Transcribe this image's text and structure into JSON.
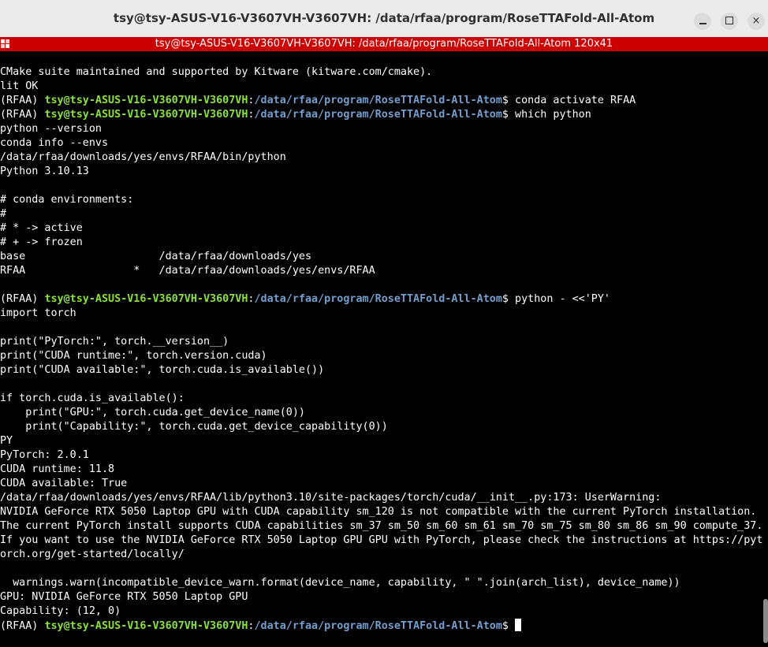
{
  "window": {
    "title": "tsy@tsy-ASUS-V16-V3607VH-V3607VH: /data/rfaa/program/RoseTTAFold-All-Atom",
    "min_label": "",
    "max_label": "",
    "close_label": "×"
  },
  "statusbar": {
    "text": "tsy@tsy-ASUS-V16-V3607VH-V3607VH: /data/rfaa/program/RoseTTAFold-All-Atom 120x41"
  },
  "prompt": {
    "env": "(RFAA) ",
    "user": "tsy@tsy-ASUS-V16-V3607VH-V3607VH",
    "colon": ":",
    "path": "/data/rfaa/program/RoseTTAFold-All-Atom",
    "dollar": "$ "
  },
  "terminal": {
    "l01": "CMake suite maintained and supported by Kitware (kitware.com/cmake).",
    "l02": "lit OK",
    "cmd03": "conda activate RFAA",
    "cmd04": "which python",
    "l05": "python --version",
    "l06": "conda info --envs",
    "l07": "/data/rfaa/downloads/yes/envs/RFAA/bin/python",
    "l08": "Python 3.10.13",
    "l09": "",
    "l10": "# conda environments:",
    "l11": "#",
    "l12": "# * -> active",
    "l13": "# + -> frozen",
    "l14": "base                     /data/rfaa/downloads/yes",
    "l15": "RFAA                 *   /data/rfaa/downloads/yes/envs/RFAA",
    "l16": "",
    "cmd17": "python - <<'PY'",
    "l18": "import torch",
    "l19": "",
    "l20": "print(\"PyTorch:\", torch.__version__)",
    "l21": "print(\"CUDA runtime:\", torch.version.cuda)",
    "l22": "print(\"CUDA available:\", torch.cuda.is_available())",
    "l23": "",
    "l24": "if torch.cuda.is_available():",
    "l25": "    print(\"GPU:\", torch.cuda.get_device_name(0))",
    "l26": "    print(\"Capability:\", torch.cuda.get_device_capability(0))",
    "l27": "PY",
    "l28": "PyTorch: 2.0.1",
    "l29": "CUDA runtime: 11.8",
    "l30": "CUDA available: True",
    "l31": "/data/rfaa/downloads/yes/envs/RFAA/lib/python3.10/site-packages/torch/cuda/__init__.py:173: UserWarning:",
    "l32": "NVIDIA GeForce RTX 5050 Laptop GPU with CUDA capability sm_120 is not compatible with the current PyTorch installation.",
    "l33": "The current PyTorch install supports CUDA capabilities sm_37 sm_50 sm_60 sm_61 sm_70 sm_75 sm_80 sm_86 sm_90 compute_37.",
    "l34": "If you want to use the NVIDIA GeForce RTX 5050 Laptop GPU GPU with PyTorch, please check the instructions at https://pyt",
    "l35": "orch.org/get-started/locally/",
    "l36": "",
    "l37": "  warnings.warn(incompatible_device_warn.format(device_name, capability, \" \".join(arch_list), device_name))",
    "l38": "GPU: NVIDIA GeForce RTX 5050 Laptop GPU",
    "l39": "Capability: (12, 0)"
  },
  "colors": {
    "background": "#000000",
    "titlebar": "#ebebeb",
    "statusbar": "#cc0000",
    "prompt_user": "#8ae234",
    "prompt_path": "#729fcf",
    "text": "#ffffff"
  }
}
